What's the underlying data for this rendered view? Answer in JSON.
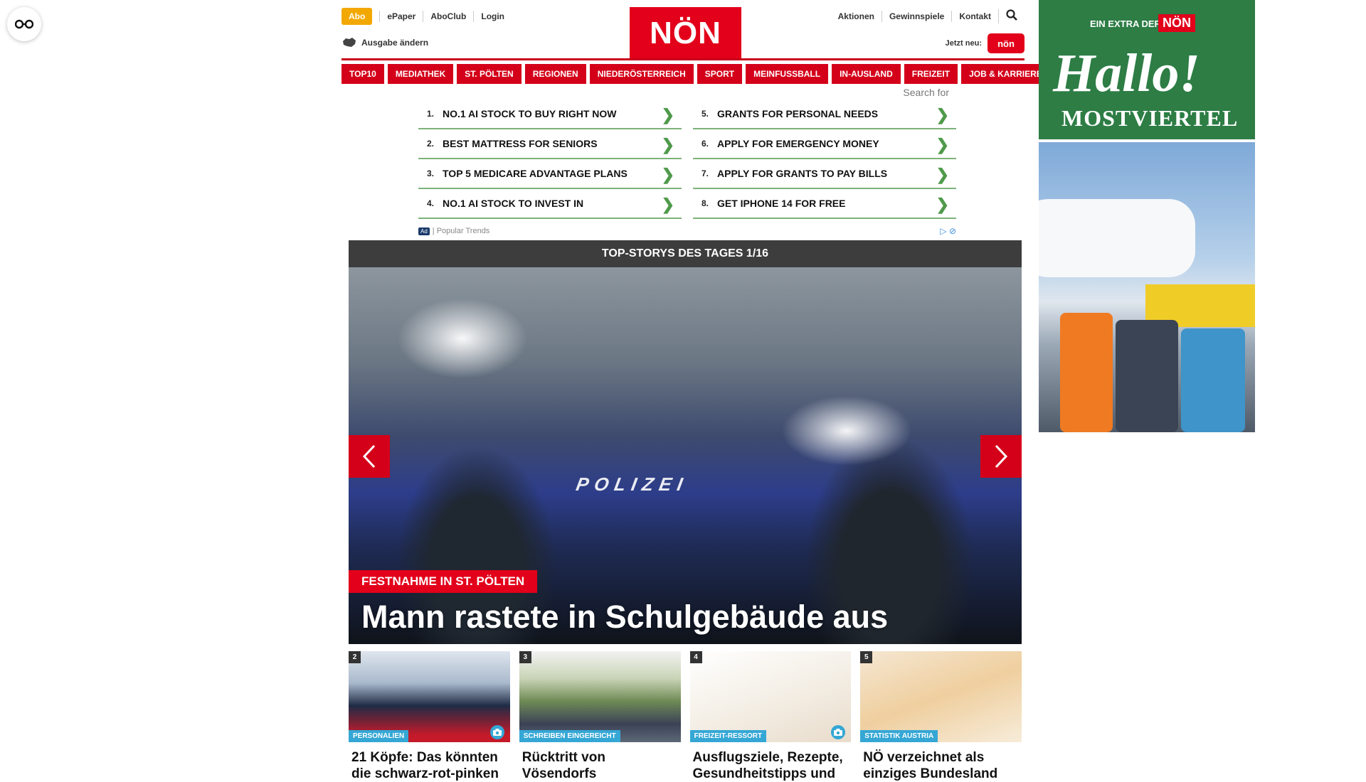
{
  "header": {
    "abo": "Abo",
    "links_left": [
      "ePaper",
      "AboClub",
      "Login"
    ],
    "ausgabe": "Ausgabe ändern",
    "logo": "NÖN",
    "links_right": [
      "Aktionen",
      "Gewinnspiele",
      "Kontakt"
    ],
    "jetzt_neu": "Jetzt neu:",
    "jetzt_logo": "nön"
  },
  "nav": [
    "TOP10",
    "MEDIATHEK",
    "ST. PÖLTEN",
    "REGIONEN",
    "NIEDERÖSTERREICH",
    "SPORT",
    "MEINFUSSBALL",
    "IN-AUSLAND",
    "FREIZEIT",
    "JOB & KARRIERE"
  ],
  "ads": {
    "search_for": "Search for",
    "left": [
      {
        "num": "1.",
        "text": "NO.1 AI STOCK TO BUY RIGHT NOW"
      },
      {
        "num": "2.",
        "text": "BEST MATTRESS FOR SENIORS"
      },
      {
        "num": "3.",
        "text": "TOP 5 MEDICARE ADVANTAGE PLANS"
      },
      {
        "num": "4.",
        "text": "NO.1 AI STOCK TO INVEST IN"
      }
    ],
    "right": [
      {
        "num": "5.",
        "text": "GRANTS FOR PERSONAL NEEDS"
      },
      {
        "num": "6.",
        "text": "APPLY FOR EMERGENCY MONEY"
      },
      {
        "num": "7.",
        "text": "APPLY FOR GRANTS TO PAY BILLS"
      },
      {
        "num": "8.",
        "text": "GET IPHONE 14 FOR FREE"
      }
    ],
    "ad_label": "Ad",
    "footer": "| Popular Trends"
  },
  "slider": {
    "title": "TOP-STORYS DES TAGES 1/16",
    "image_text": "POLIZEI",
    "kicker": "FESTNAHME IN ST. PÖLTEN",
    "headline": "Mann rastete in Schulgebäude aus"
  },
  "teasers": [
    {
      "num": "2",
      "category": "PERSONALIEN",
      "title": "21 Köpfe: Das könnten die schwarz-rot-pinken"
    },
    {
      "num": "3",
      "category": "SCHREIBEN EINGEREICHT",
      "title": "Rücktritt von Vösendorfs"
    },
    {
      "num": "4",
      "category": "FREIZEIT-RESSORT",
      "title": "Ausflugsziele, Rezepte, Gesundheitstipps und"
    },
    {
      "num": "5",
      "category": "STATISTIK AUSTRIA",
      "title": "NÖ verzeichnet als einziges Bundesland"
    }
  ],
  "right_ad": {
    "extra": "EIN EXTRA DER",
    "noen": "NÖN",
    "hallo": "Hallo!",
    "mostviertel": "MOSTVIERTEL"
  },
  "colors": {
    "brand_red": "#e2001a",
    "abo": "#f2a800",
    "ad_green": "#2d7d45",
    "category_blue": "#35a7d5"
  }
}
